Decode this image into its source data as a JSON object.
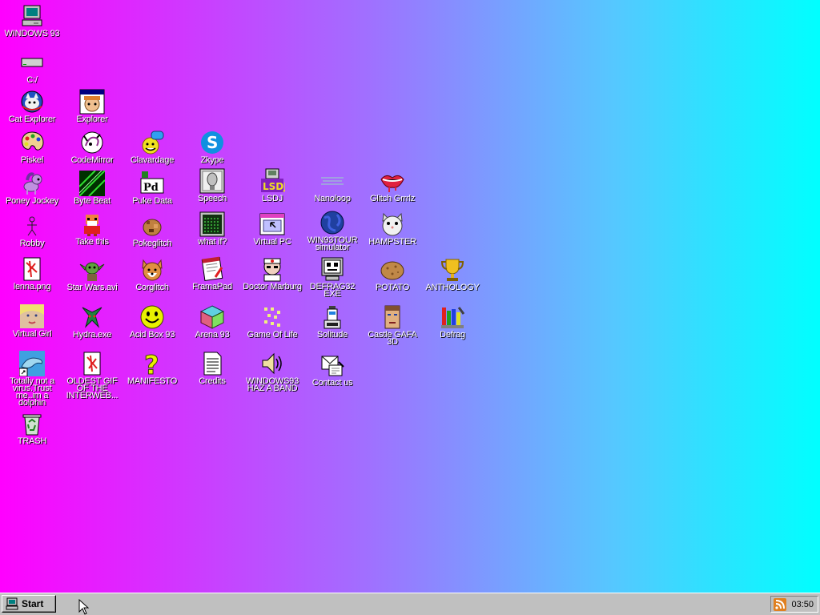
{
  "desktop": {
    "icons": {
      "windows93": "WINDOWS 93",
      "c_drive": "C:/",
      "cat_explorer": "Cat Explorer",
      "explorer": "Explorer",
      "piskel": "Piskel",
      "codemirror": "CodeMirror",
      "clavardage": "Clavardage",
      "zkype": "Zkype",
      "poney_jockey": "Poney Jockey",
      "byte_beat": "Byte Beat",
      "puke_data": "Puke Data",
      "speech": "Speech",
      "lsdj": "LSDJ",
      "nanoloop": "Nanoloop",
      "glitch_grrrlz": "Glitch Grrrlz",
      "robby": "Robby",
      "take_this": "Take this",
      "pokeglitch": "Pokeglitch",
      "what_if": "what if?",
      "virtual_pc": "Virtual PC",
      "win93tour": "WIN93TOUR simulator",
      "hampster": "HAMPSTER",
      "lenna": "lenna.png",
      "star_wars": "Star Wars.avi",
      "corglitch": "Corglitch",
      "framapad": "FramaPad",
      "doctor_marburg": "Doctor Marburg",
      "defrag32": "DEFRAG32 EXE",
      "potato": "POTATO",
      "anthology": "ANTHOLOGY",
      "virtual_girl": "Virtual Girl",
      "hydra": "Hydra.exe",
      "acid_box": "Acid Box 93",
      "arena93": "Arena 93",
      "game_of_life": "Game Of Life",
      "solitude": "Solitude",
      "castle_gafa": "Castle GAFA 3D",
      "defrag": "Defrag",
      "dolphin": "Totally not a virus.Trust me..im a dolphin",
      "oldest_gif": "OLDEST GIF OF THE INTERWEB...",
      "manifesto": "MANIFESTO",
      "credits": "Credits",
      "band": "WINDOWS93 HAZ A BAND",
      "contact": "Contact us",
      "trash": "TRASH"
    }
  },
  "taskbar": {
    "start_label": "Start",
    "clock": "03:50"
  },
  "colors": {
    "gradient_left": "#ff00ff",
    "gradient_right": "#00ffff",
    "taskbar": "#c0c0c0",
    "tray_icon": "#e08020"
  }
}
